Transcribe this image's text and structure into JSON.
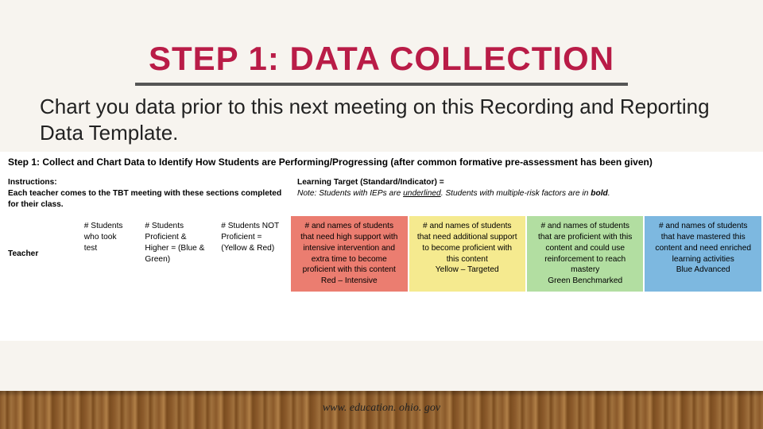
{
  "title": "STEP 1: DATA COLLECTION",
  "subtitle": "Chart you data prior to this next meeting on this Recording and Reporting Data Template.",
  "step_heading": "Step 1: Collect and Chart Data to Identify How Students are Performing/Progressing (after common formative pre-assessment has been given)",
  "instructions_label": "Instructions:",
  "instructions_text": "Each teacher comes to the TBT meeting with these sections completed for their class.",
  "learning_target_label": "Learning Target (Standard/Indicator) =",
  "note_prefix": "Note:",
  "note_mid1": " Students with IEPs are ",
  "note_underlined": "underlined",
  "note_mid2": ". Students with multiple-risk factors are in ",
  "note_bold": "bold",
  "note_end": ".",
  "row3": {
    "teacher_label": "Teacher",
    "col_students_took_test": "# Students who took test",
    "col_proficient": "# Students Proficient & Higher = (Blue & Green)",
    "col_not_proficient": "# Students NOT Proficient = (Yellow & Red)",
    "red": "# and names of students that need high support with intensive intervention and extra time to become proficient with this content\nRed – Intensive",
    "yellow": "# and names of students that need additional support to become proficient with this content\nYellow – Targeted",
    "green": "# and names of students that are proficient with this content and could use reinforcement to reach mastery\nGreen Benchmarked",
    "blue": "# and names of students that have mastered this content and need enriched learning activities\nBlue Advanced"
  },
  "footer": "www. education. ohio. gov"
}
